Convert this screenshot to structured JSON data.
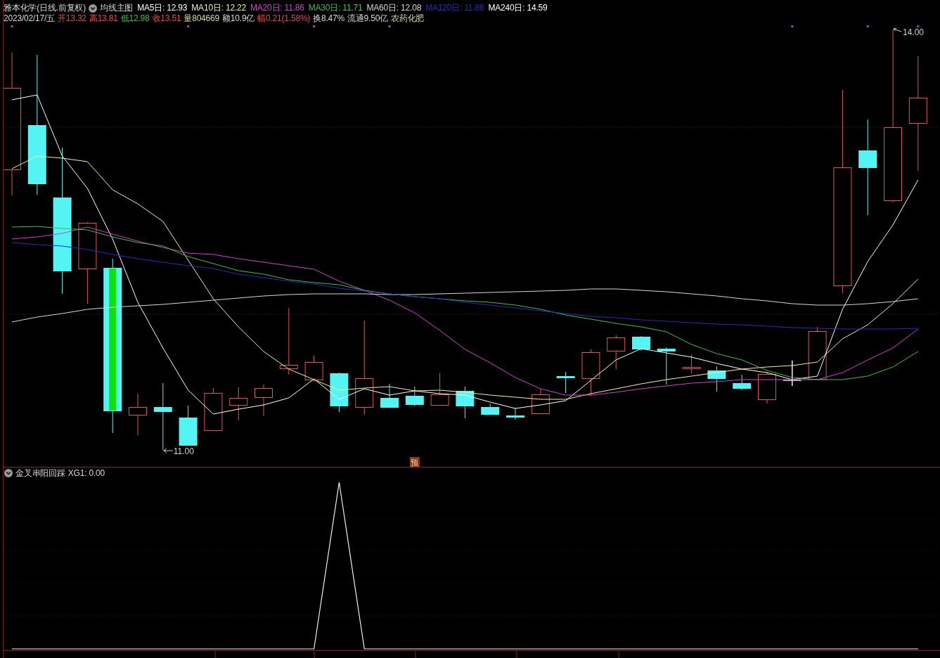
{
  "header": {
    "title": "雅本化学(日线.前复权)",
    "indicator_name": "均线主图",
    "moving_averages": [
      {
        "text": "MA5日: 12.93",
        "color": "#ffffff"
      },
      {
        "text": "MA10日: 12.22",
        "color": "#f0f0a8"
      },
      {
        "text": "MA20日: 11.86",
        "color": "#d040d0"
      },
      {
        "text": "MA30日: 11.71",
        "color": "#40c040"
      },
      {
        "text": "MA60日: 12.08",
        "color": "#d8d8d8"
      },
      {
        "text": "MA120日: 11.86",
        "color": "#2030c0"
      },
      {
        "text": "MA240日: 14.59",
        "color": "#ffffff"
      }
    ]
  },
  "quote": [
    {
      "text": "2023/02/17/五",
      "color": "#d8d8d8"
    },
    {
      "text": "开13.32",
      "color": "#e84848"
    },
    {
      "text": "高13.81",
      "color": "#e84848"
    },
    {
      "text": "低12.98",
      "color": "#40c040"
    },
    {
      "text": "收13.51",
      "color": "#e84848"
    },
    {
      "text": "量804669",
      "color": "#d8d8a0"
    },
    {
      "text": "额10.9亿",
      "color": "#d8d8d8"
    },
    {
      "text": "幅0.21(1.58%)",
      "color": "#e84848"
    },
    {
      "text": "换8.47%",
      "color": "#d8d8d8"
    },
    {
      "text": "流通9.50亿",
      "color": "#d8d8d8"
    },
    {
      "text": "农药化肥",
      "color": "#d8d8a0"
    }
  ],
  "main_chart": {
    "high_label": "14.00",
    "low_label": "11.00",
    "forecast_badge": "预"
  },
  "indicator_panel": {
    "title": "金叉串阳回踩",
    "reading": "XG1: 0.00"
  }
}
